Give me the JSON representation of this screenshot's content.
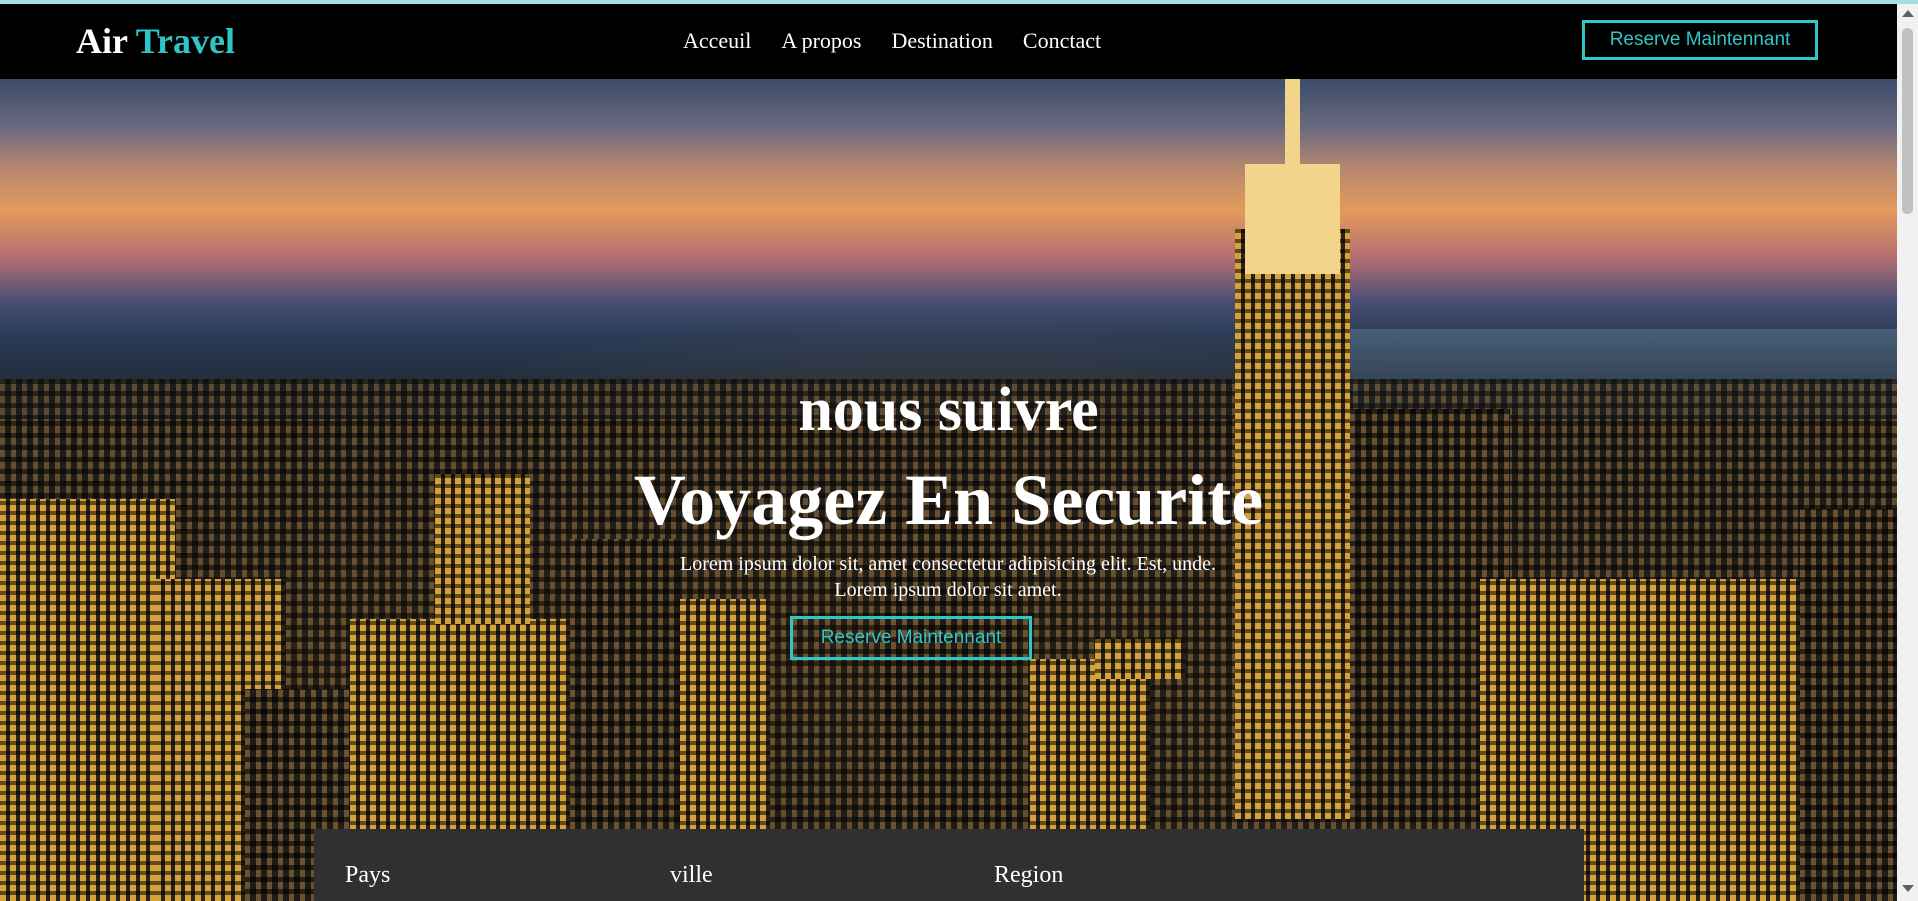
{
  "header": {
    "logo_main": "Air",
    "logo_accent": "Travel",
    "nav": [
      "Acceuil",
      "A propos",
      "Destination",
      "Conctact"
    ],
    "cta_label": "Reserve Maintennant"
  },
  "hero": {
    "subtitle": "nous suivre",
    "title": "Voyagez En Securite",
    "description_line1": "Lorem ipsum dolor sit, amet consectetur adipisicing elit. Est, unde.",
    "description_line2": "Lorem ipsum dolor sit amet.",
    "cta_label": "Reserve Maintennant"
  },
  "search": {
    "labels": [
      "Pays",
      "ville",
      "Region"
    ]
  },
  "colors": {
    "accent": "#2ec7c7",
    "navbar": "#000000",
    "panel": "#303030"
  }
}
